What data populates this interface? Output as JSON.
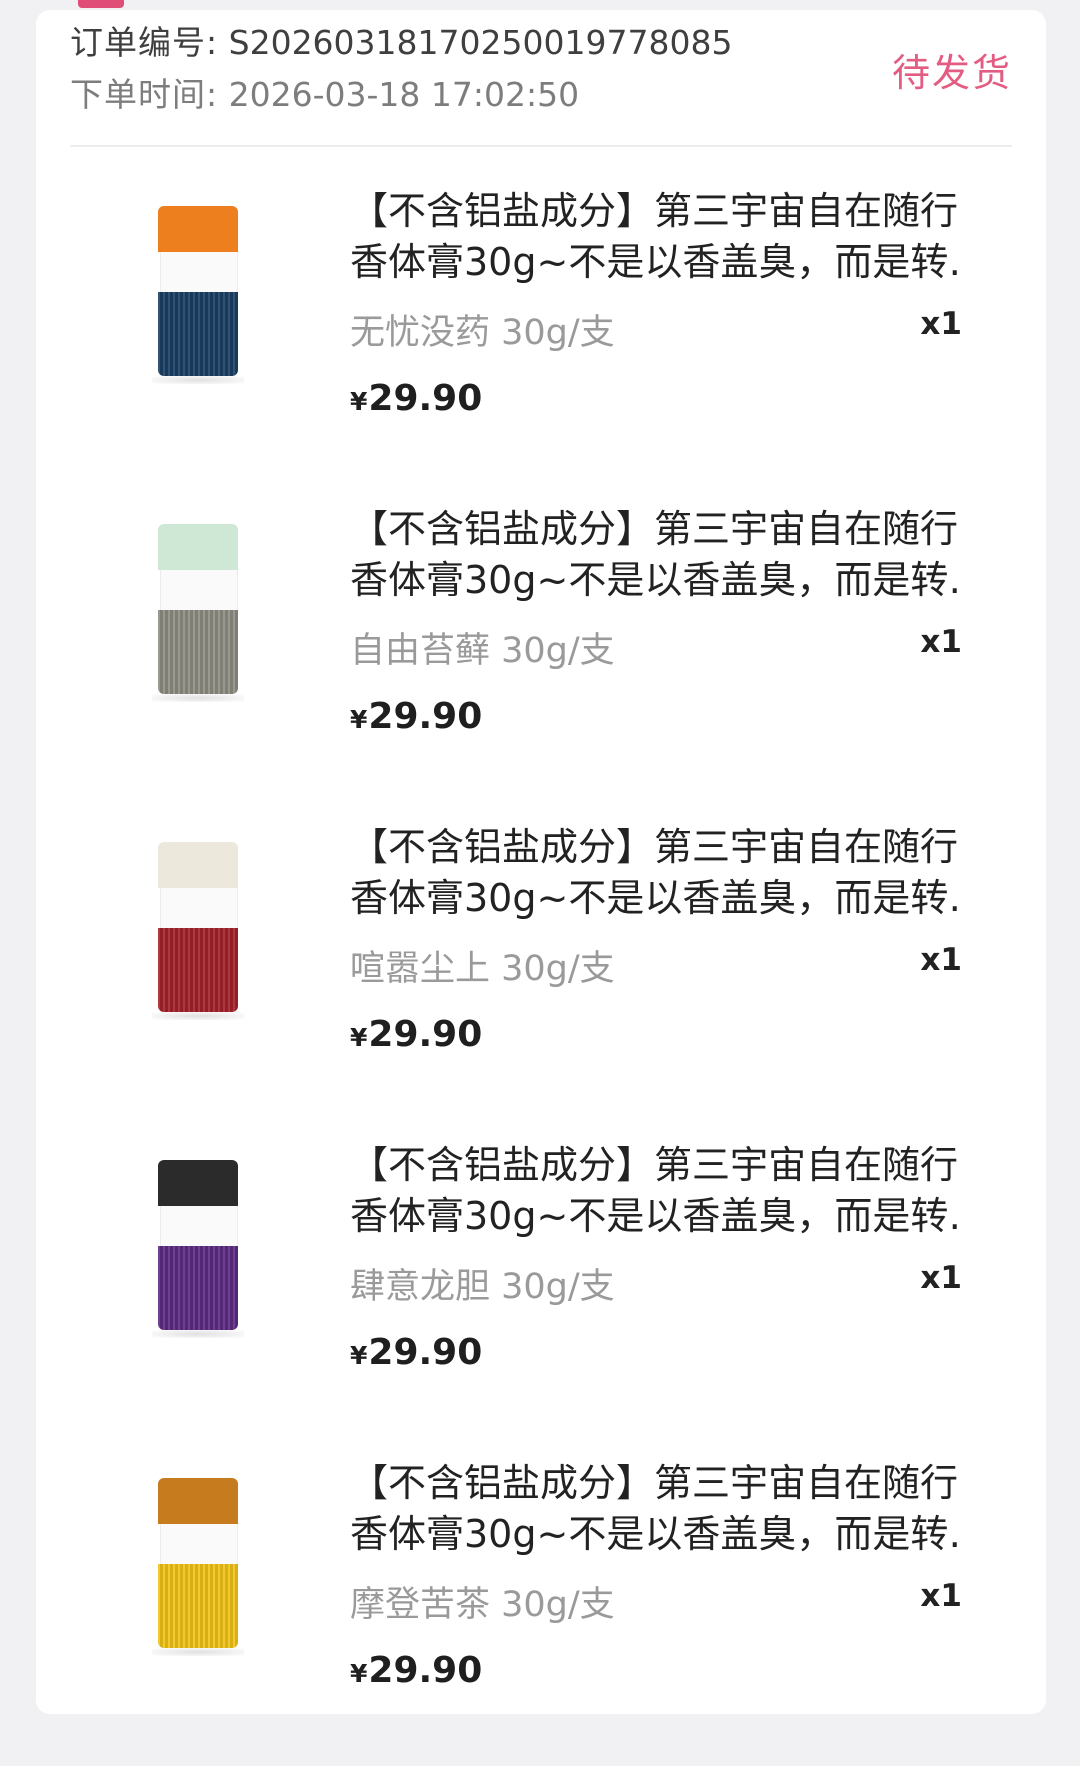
{
  "order": {
    "number_label": "订单编号:",
    "number": "S2026031817025001977808​5",
    "time_label": "下单时间:",
    "time": "2026-03-18 17:02:50",
    "status": "待发货"
  },
  "items": [
    {
      "title_line1": "【不含铝盐成分】第三宇宙自在随行",
      "title_line2": "香体膏30g~不是以香盖臭，而是转…",
      "variant": "无忧没药 30g/支",
      "qty": "x1",
      "currency": "¥",
      "price": "29.90",
      "cap_color": "#ee7f1f",
      "body_color": "#1b3f63"
    },
    {
      "title_line1": "【不含铝盐成分】第三宇宙自在随行",
      "title_line2": "香体膏30g~不是以香盖臭，而是转…",
      "variant": "自由苔藓 30g/支",
      "qty": "x1",
      "currency": "¥",
      "price": "29.90",
      "cap_color": "#cfe8d6",
      "body_color": "#8f8d82"
    },
    {
      "title_line1": "【不含铝盐成分】第三宇宙自在随行",
      "title_line2": "香体膏30g~不是以香盖臭，而是转…",
      "variant": "喧嚣尘上 30g/支",
      "qty": "x1",
      "currency": "¥",
      "price": "29.90",
      "cap_color": "#ece9dc",
      "body_color": "#a4222a"
    },
    {
      "title_line1": "【不含铝盐成分】第三宇宙自在随行",
      "title_line2": "香体膏30g~不是以香盖臭，而是转…",
      "variant": "肆意龙胆 30g/支",
      "qty": "x1",
      "currency": "¥",
      "price": "29.90",
      "cap_color": "#2b2b2b",
      "body_color": "#5e2b83"
    },
    {
      "title_line1": "【不含铝盐成分】第三宇宙自在随行",
      "title_line2": "香体膏30g~不是以香盖臭，而是转…",
      "variant": "摩登苦茶 30g/支",
      "qty": "x1",
      "currency": "¥",
      "price": "29.90",
      "cap_color": "#c67b1f",
      "body_color": "#f2c319"
    }
  ]
}
